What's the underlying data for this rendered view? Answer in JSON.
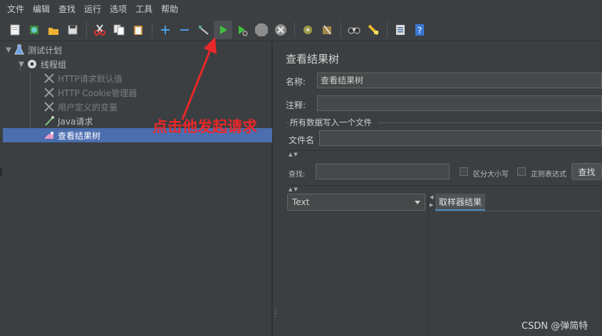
{
  "menu": [
    "文件",
    "编辑",
    "查找",
    "运行",
    "选项",
    "工具",
    "帮助"
  ],
  "toolbar": {
    "tooltip": "启动",
    "icons": [
      "new-icon",
      "templates-icon",
      "open-icon",
      "save-icon",
      "cut-icon",
      "copy-icon",
      "paste-icon",
      "expand-icon",
      "collapse-icon",
      "toggle-icon",
      "start-icon",
      "start-no-pause-icon",
      "stop-icon",
      "shutdown-icon",
      "clear-icon",
      "clear-all-icon",
      "search-icon",
      "reset-search-icon",
      "function-helper-icon",
      "help-icon"
    ]
  },
  "tree": {
    "items": [
      {
        "label": "测试计划"
      },
      {
        "label": "线程组"
      },
      {
        "label": "HTTP请求默认值"
      },
      {
        "label": "HTTP Cookie管理器"
      },
      {
        "label": "用户定义的变量"
      },
      {
        "label": "Java请求"
      },
      {
        "label": "查看结果树"
      }
    ]
  },
  "annotation": "点击他发起请求",
  "panel": {
    "title": "查看结果树",
    "name_label": "名称:",
    "name_value": "查看结果树",
    "comment_label": "注释:",
    "group_title": "所有数据写入一个文件",
    "filename_label": "文件名",
    "search_label": "查找:",
    "case_label": "区分大小写",
    "regex_label": "正则表达式",
    "search_button": "查找",
    "renderer_selected": "Text",
    "tab_label": "取样器结果"
  },
  "watermark": "CSDN @弹简特",
  "colors": {
    "accent": "#4b6eaf",
    "annotation": "#e8282a",
    "background": "#3c3f41"
  }
}
